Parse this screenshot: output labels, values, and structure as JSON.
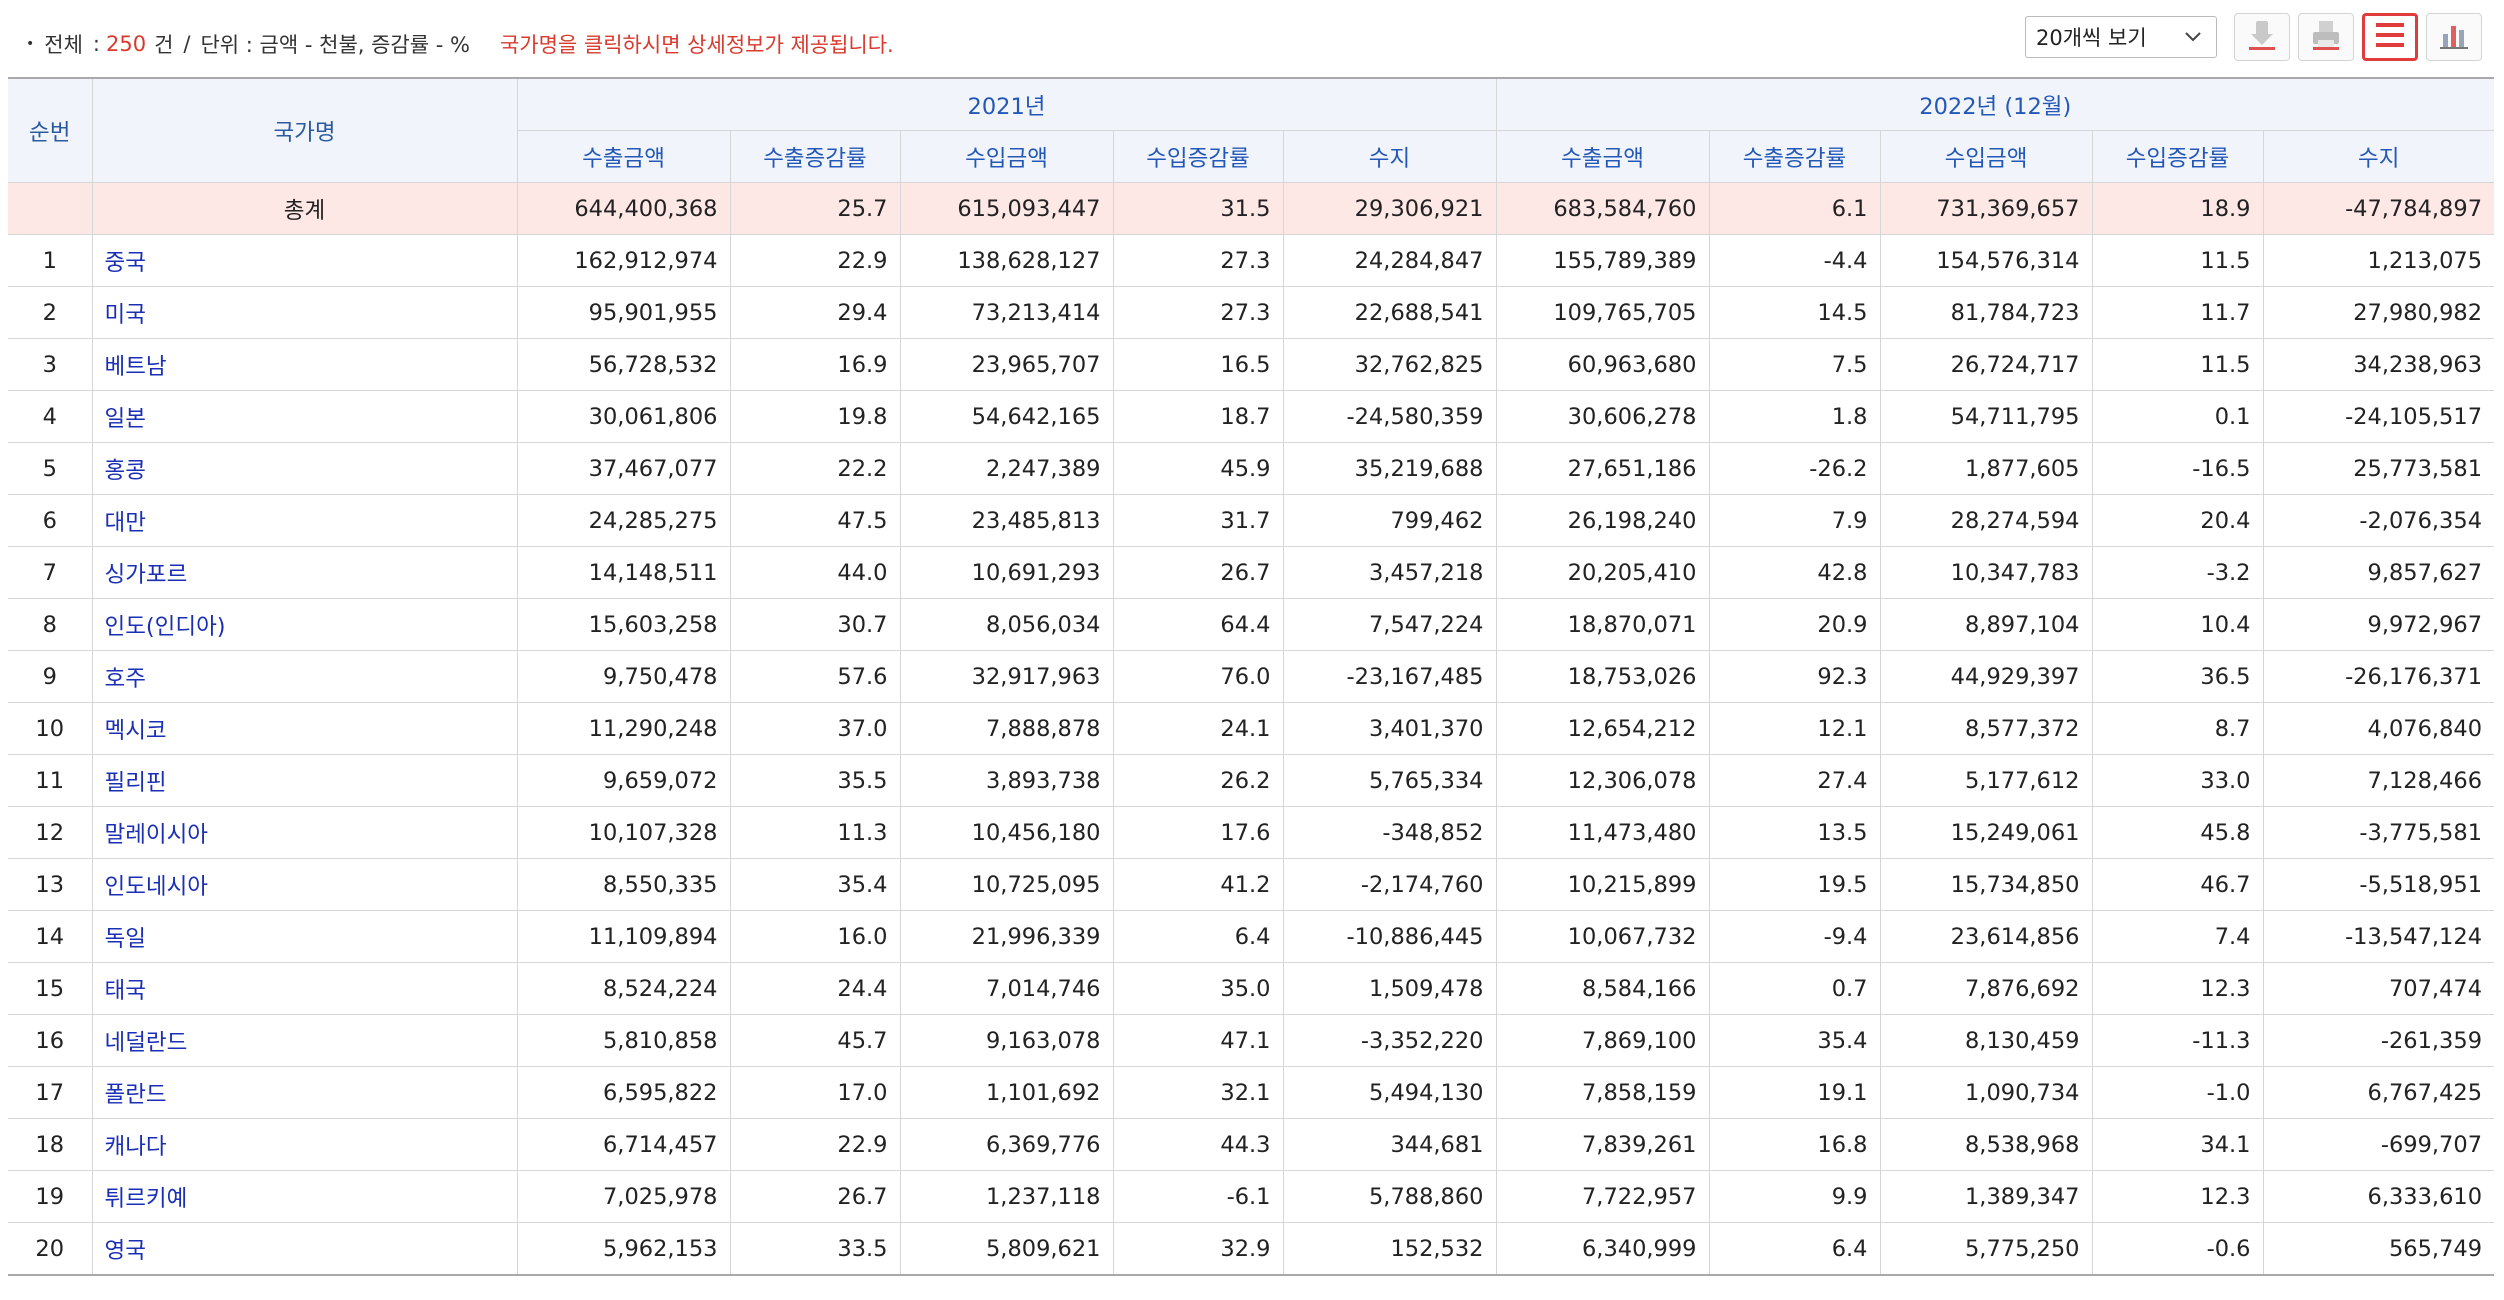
{
  "summary": {
    "bullet": "•",
    "total_label": "전체",
    "separator": ":",
    "total_count": "250",
    "count_unit": "건",
    "slash": "/",
    "unit_text": "단위 : 금액 - 천불, 증감률 - %",
    "notice": "국가명을 클릭하시면 상세정보가 제공됩니다."
  },
  "toolbar": {
    "page_size_selected": "20개씩 보기",
    "icons": [
      "download-icon",
      "print-icon",
      "list-view-icon",
      "chart-view-icon"
    ],
    "accent_color": "#e03c3c"
  },
  "table": {
    "headers": {
      "no": "순번",
      "name": "국가명",
      "group1": "2021년",
      "group2": "2022년 (12월)",
      "sub": [
        "수출금액",
        "수출증감률",
        "수입금액",
        "수입증감률",
        "수지"
      ]
    },
    "total": {
      "label": "총계",
      "values": [
        "644,400,368",
        "25.7",
        "615,093,447",
        "31.5",
        "29,306,921",
        "683,584,760",
        "6.1",
        "731,369,657",
        "18.9",
        "-47,784,897"
      ]
    },
    "rows": [
      {
        "no": "1",
        "name": "중국",
        "values": [
          "162,912,974",
          "22.9",
          "138,628,127",
          "27.3",
          "24,284,847",
          "155,789,389",
          "-4.4",
          "154,576,314",
          "11.5",
          "1,213,075"
        ]
      },
      {
        "no": "2",
        "name": "미국",
        "values": [
          "95,901,955",
          "29.4",
          "73,213,414",
          "27.3",
          "22,688,541",
          "109,765,705",
          "14.5",
          "81,784,723",
          "11.7",
          "27,980,982"
        ]
      },
      {
        "no": "3",
        "name": "베트남",
        "values": [
          "56,728,532",
          "16.9",
          "23,965,707",
          "16.5",
          "32,762,825",
          "60,963,680",
          "7.5",
          "26,724,717",
          "11.5",
          "34,238,963"
        ]
      },
      {
        "no": "4",
        "name": "일본",
        "values": [
          "30,061,806",
          "19.8",
          "54,642,165",
          "18.7",
          "-24,580,359",
          "30,606,278",
          "1.8",
          "54,711,795",
          "0.1",
          "-24,105,517"
        ]
      },
      {
        "no": "5",
        "name": "홍콩",
        "values": [
          "37,467,077",
          "22.2",
          "2,247,389",
          "45.9",
          "35,219,688",
          "27,651,186",
          "-26.2",
          "1,877,605",
          "-16.5",
          "25,773,581"
        ]
      },
      {
        "no": "6",
        "name": "대만",
        "values": [
          "24,285,275",
          "47.5",
          "23,485,813",
          "31.7",
          "799,462",
          "26,198,240",
          "7.9",
          "28,274,594",
          "20.4",
          "-2,076,354"
        ]
      },
      {
        "no": "7",
        "name": "싱가포르",
        "values": [
          "14,148,511",
          "44.0",
          "10,691,293",
          "26.7",
          "3,457,218",
          "20,205,410",
          "42.8",
          "10,347,783",
          "-3.2",
          "9,857,627"
        ]
      },
      {
        "no": "8",
        "name": "인도(인디아)",
        "values": [
          "15,603,258",
          "30.7",
          "8,056,034",
          "64.4",
          "7,547,224",
          "18,870,071",
          "20.9",
          "8,897,104",
          "10.4",
          "9,972,967"
        ]
      },
      {
        "no": "9",
        "name": "호주",
        "values": [
          "9,750,478",
          "57.6",
          "32,917,963",
          "76.0",
          "-23,167,485",
          "18,753,026",
          "92.3",
          "44,929,397",
          "36.5",
          "-26,176,371"
        ]
      },
      {
        "no": "10",
        "name": "멕시코",
        "values": [
          "11,290,248",
          "37.0",
          "7,888,878",
          "24.1",
          "3,401,370",
          "12,654,212",
          "12.1",
          "8,577,372",
          "8.7",
          "4,076,840"
        ]
      },
      {
        "no": "11",
        "name": "필리핀",
        "values": [
          "9,659,072",
          "35.5",
          "3,893,738",
          "26.2",
          "5,765,334",
          "12,306,078",
          "27.4",
          "5,177,612",
          "33.0",
          "7,128,466"
        ]
      },
      {
        "no": "12",
        "name": "말레이시아",
        "values": [
          "10,107,328",
          "11.3",
          "10,456,180",
          "17.6",
          "-348,852",
          "11,473,480",
          "13.5",
          "15,249,061",
          "45.8",
          "-3,775,581"
        ]
      },
      {
        "no": "13",
        "name": "인도네시아",
        "values": [
          "8,550,335",
          "35.4",
          "10,725,095",
          "41.2",
          "-2,174,760",
          "10,215,899",
          "19.5",
          "15,734,850",
          "46.7",
          "-5,518,951"
        ]
      },
      {
        "no": "14",
        "name": "독일",
        "values": [
          "11,109,894",
          "16.0",
          "21,996,339",
          "6.4",
          "-10,886,445",
          "10,067,732",
          "-9.4",
          "23,614,856",
          "7.4",
          "-13,547,124"
        ]
      },
      {
        "no": "15",
        "name": "태국",
        "values": [
          "8,524,224",
          "24.4",
          "7,014,746",
          "35.0",
          "1,509,478",
          "8,584,166",
          "0.7",
          "7,876,692",
          "12.3",
          "707,474"
        ]
      },
      {
        "no": "16",
        "name": "네덜란드",
        "values": [
          "5,810,858",
          "45.7",
          "9,163,078",
          "47.1",
          "-3,352,220",
          "7,869,100",
          "35.4",
          "8,130,459",
          "-11.3",
          "-261,359"
        ]
      },
      {
        "no": "17",
        "name": "폴란드",
        "values": [
          "6,595,822",
          "17.0",
          "1,101,692",
          "32.1",
          "5,494,130",
          "7,858,159",
          "19.1",
          "1,090,734",
          "-1.0",
          "6,767,425"
        ]
      },
      {
        "no": "18",
        "name": "캐나다",
        "values": [
          "6,714,457",
          "22.9",
          "6,369,776",
          "44.3",
          "344,681",
          "7,839,261",
          "16.8",
          "8,538,968",
          "34.1",
          "-699,707"
        ]
      },
      {
        "no": "19",
        "name": "튀르키예",
        "values": [
          "7,025,978",
          "26.7",
          "1,237,118",
          "-6.1",
          "5,788,860",
          "7,722,957",
          "9.9",
          "1,389,347",
          "12.3",
          "6,333,610"
        ]
      },
      {
        "no": "20",
        "name": "영국",
        "values": [
          "5,962,153",
          "33.5",
          "5,809,621",
          "32.9",
          "152,532",
          "6,340,999",
          "6.4",
          "5,775,250",
          "-0.6",
          "565,749"
        ]
      }
    ]
  }
}
